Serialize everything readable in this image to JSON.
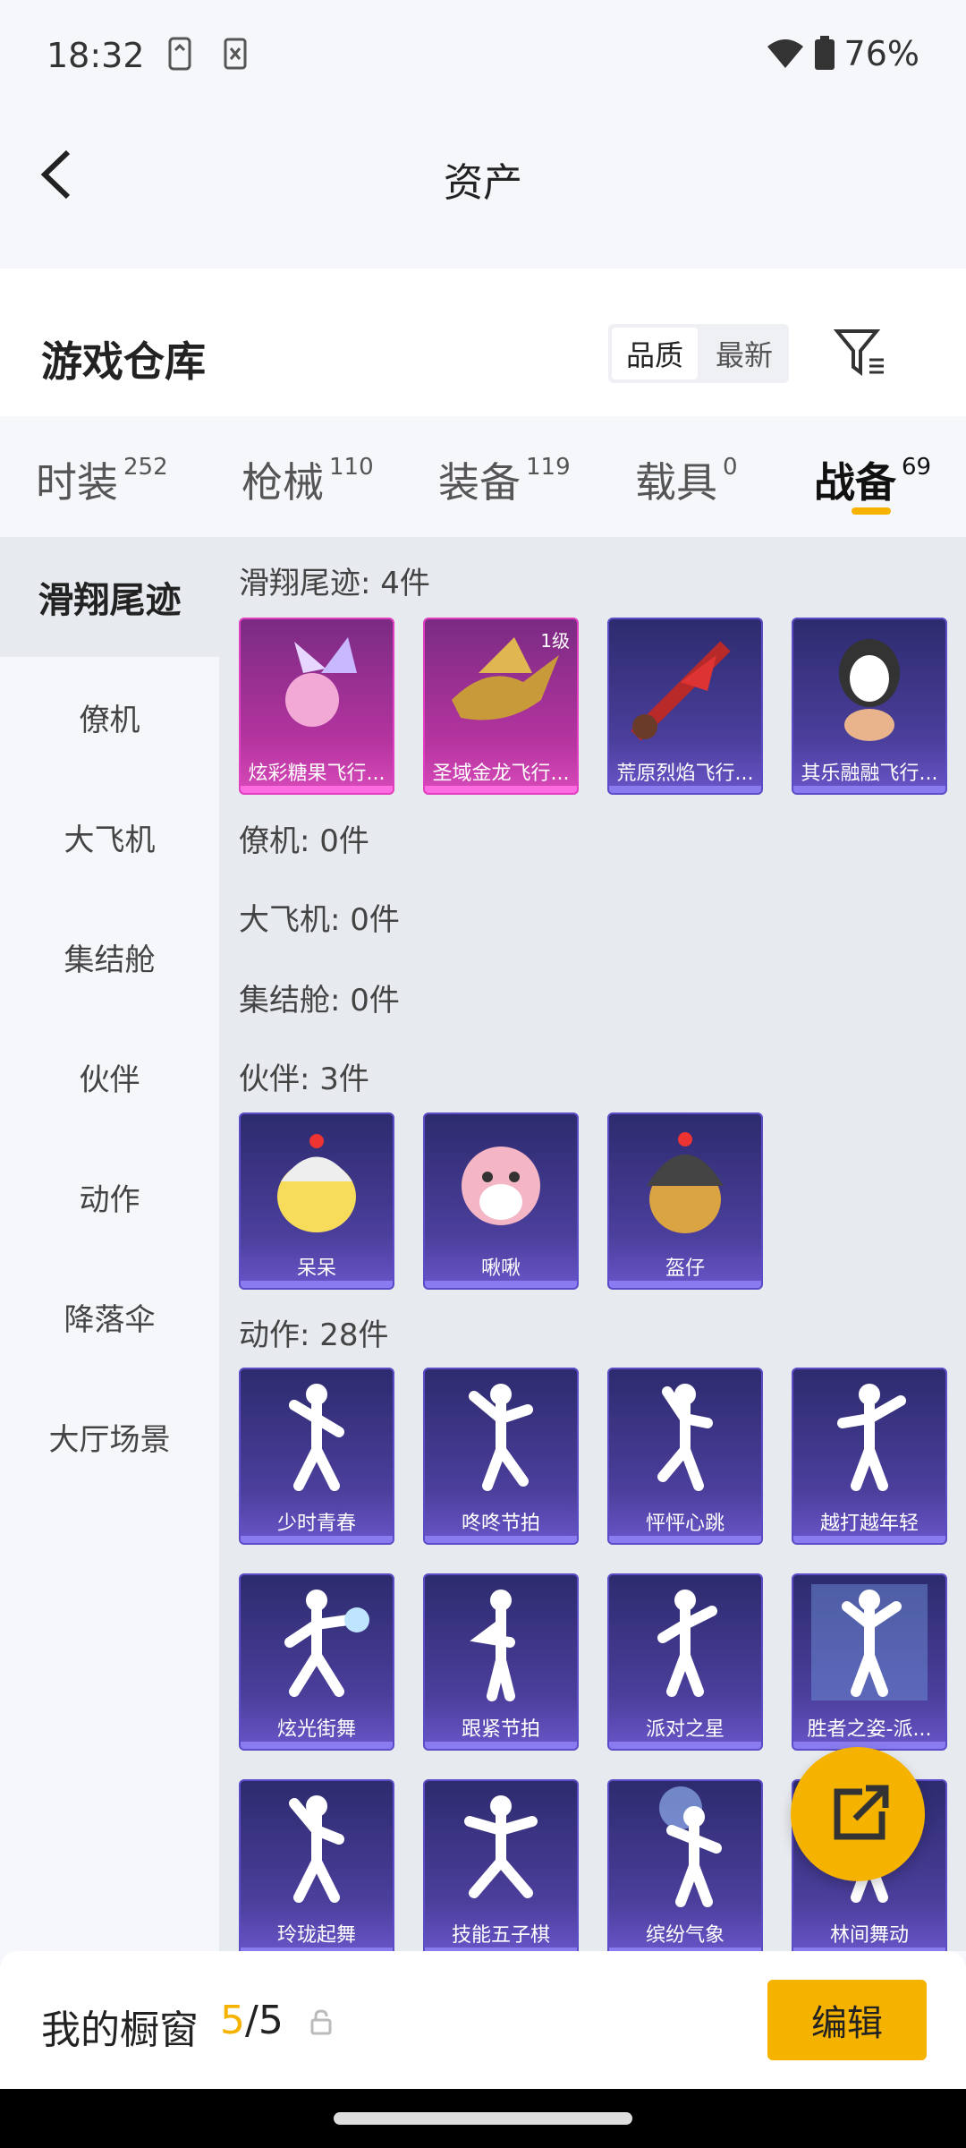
{
  "status_bar": {
    "time": "18:32",
    "battery": "76%"
  },
  "header": {
    "title": "资产"
  },
  "warehouse": {
    "title": "游戏仓库",
    "sort_quality": "品质",
    "sort_newest": "最新"
  },
  "tabs": [
    {
      "label": "时装",
      "count": "252"
    },
    {
      "label": "枪械",
      "count": "110"
    },
    {
      "label": "装备",
      "count": "119"
    },
    {
      "label": "载具",
      "count": "0"
    },
    {
      "label": "战备",
      "count": "69"
    }
  ],
  "sidebar": [
    "滑翔尾迹",
    "僚机",
    "大飞机",
    "集结舱",
    "伙伴",
    "动作",
    "降落伞",
    "大厅场景"
  ],
  "sections": {
    "glide": "滑翔尾迹: 4件",
    "wingman": "僚机: 0件",
    "plane": "大飞机: 0件",
    "capsule": "集结舱: 0件",
    "partner": "伙伴: 3件",
    "action": "动作: 28件"
  },
  "glide_items": [
    {
      "name": "炫彩糖果飞行...",
      "level": ""
    },
    {
      "name": "圣域金龙飞行...",
      "level": "1级"
    },
    {
      "name": "荒原烈焰飞行...",
      "level": ""
    },
    {
      "name": "其乐融融飞行...",
      "level": ""
    }
  ],
  "partner_items": [
    "呆呆",
    "啾啾",
    "盔仔"
  ],
  "action_items": [
    "少时青春",
    "咚咚节拍",
    "怦怦心跳",
    "越打越年轻",
    "炫光街舞",
    "跟紧节拍",
    "派对之星",
    "胜者之姿-派...",
    "玲珑起舞",
    "技能五子棋",
    "缤纷气象",
    "林间舞动"
  ],
  "showcase": {
    "label": "我的橱窗",
    "current": "5",
    "total": "/5",
    "edit": "编辑"
  },
  "colors": {
    "accent": "#f5b300",
    "epic_border": "#5b4dc7",
    "legendary_border": "#e040c0"
  }
}
